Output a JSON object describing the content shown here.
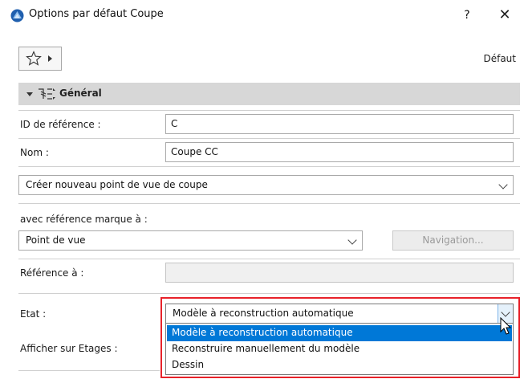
{
  "window": {
    "title": "Options par défaut Coupe",
    "help_label": "?",
    "close_label": "✕"
  },
  "toolbar": {
    "favorites_icon": "star-icon",
    "default_label": "Défaut"
  },
  "section": {
    "title": "Général",
    "icon": "section-marker-icon"
  },
  "fields": {
    "reference_id": {
      "label": "ID de référence :",
      "value": "C"
    },
    "name": {
      "label": "Nom :",
      "value": "Coupe CC"
    },
    "viewpoint_mode": {
      "value": "Créer nouveau point de vue de coupe"
    },
    "reference_marker": {
      "label": "avec référence marque à :",
      "value": "Point de vue",
      "navigation_label": "Navigation..."
    },
    "reference_to": {
      "label": "Référence à :",
      "value": ""
    },
    "state": {
      "label": "Etat :",
      "value": "Modèle à reconstruction automatique",
      "options": [
        "Modèle à reconstruction automatique",
        "Reconstruire manuellement du modèle",
        "Dessin"
      ],
      "selected_index": 0
    },
    "show_on_stories": {
      "label": "Afficher sur Etages :"
    }
  },
  "colors": {
    "accent": "#0078d7",
    "highlight": "#e8222a",
    "section_bg": "#d7d7d7"
  }
}
